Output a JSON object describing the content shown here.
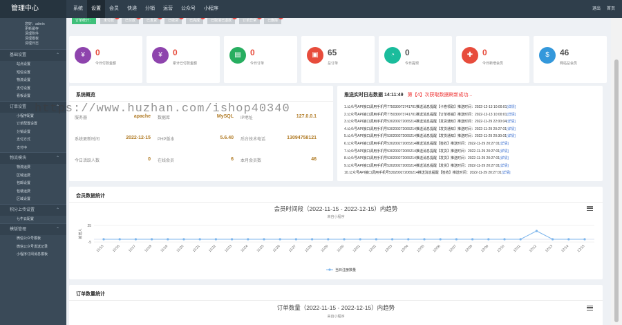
{
  "topbar": {
    "brand": "管理中心",
    "nav": [
      "系统",
      "设置",
      "会员",
      "快递",
      "分销",
      "运营",
      "公众号",
      "小程序"
    ],
    "active_index": 1,
    "right": [
      "退出",
      "首页"
    ]
  },
  "sidebar": {
    "user_lines": [
      "您好：admin",
      "更新缓存",
      "清理附件",
      "清理模板",
      "清理日志"
    ],
    "sections": [
      {
        "title": "基础设置",
        "items": [
          "站点设置",
          "短信设置",
          "物流设置",
          "支付设置",
          "看板设置"
        ]
      },
      {
        "title": "订单设置",
        "items": [
          "小程序配置",
          "订单配置设置",
          "分销设置",
          "支付方式",
          "支付中"
        ]
      },
      {
        "title": "物流模块",
        "items": [
          "物流运费",
          "区域运费",
          "包邮设置",
          "包装运费",
          "区域设置"
        ]
      },
      {
        "title": "积分上传设置",
        "items": [
          "七牛云配置"
        ]
      },
      {
        "title": "模版管理",
        "items": [
          "微信公众号模板",
          "微信公众号发送记录",
          "小程序订阅消息模板"
        ]
      }
    ]
  },
  "filterbar": {
    "chips": [
      "订单统计：",
      "未付款",
      "已付款",
      "已发货",
      "已收货",
      "已完成",
      "已取消已退款",
      "订单异常",
      "已删除"
    ]
  },
  "stats": [
    {
      "value": "0",
      "label": "今日付款金额",
      "icon": "yen-icon",
      "color": "#8e44ad"
    },
    {
      "value": "0",
      "label": "累计已付款金额",
      "icon": "yen-icon",
      "color": "#8e44ad"
    },
    {
      "value": "0",
      "label": "今日订单",
      "icon": "document-icon",
      "color": "#27ae60"
    },
    {
      "value": "65",
      "label": "总订单",
      "icon": "list-icon",
      "color": "#e74c3c"
    },
    {
      "value": "0",
      "label": "今日提现",
      "icon": "pie-icon",
      "color": "#1abc9c"
    },
    {
      "value": "0",
      "label": "今日新增会员",
      "icon": "user-plus-icon",
      "color": "#e74c3c"
    },
    {
      "value": "46",
      "label": "网站总会员",
      "icon": "moneybag-icon",
      "color": "#3498db"
    }
  ],
  "system": {
    "title": "系统概览",
    "rows": [
      [
        {
          "k": "服务器",
          "v": "apache"
        },
        {
          "k": "数据库",
          "v": "MySQL"
        },
        {
          "k": "IP地址",
          "v": "127.0.0.1"
        }
      ],
      [
        {
          "k": "系统更新时间",
          "v": "2022-12-15"
        },
        {
          "k": "PHP版本",
          "v": "5.6.40"
        },
        {
          "k": "后台技术电话",
          "v": "13094758121"
        }
      ],
      [
        {
          "k": "今日活跃人数",
          "v": "0"
        },
        {
          "k": "在线会员",
          "v": "6"
        },
        {
          "k": "本月会员数",
          "v": "46"
        }
      ]
    ]
  },
  "log": {
    "title": "推送实时日志数据 14:11:49",
    "alert": "第【4】次获取数据刷新成功...",
    "lines": [
      {
        "text": "1.公众号API接口调用手机号775030073741701推送消息提醒【卡卷领取】推送时间：2022-12-13 10:00:01",
        "link": "[详情]"
      },
      {
        "text": "2.公众号API接口调用手机号775030073741701推送消息提醒【订单核销】推送时间：2022-12-13 10:00:01",
        "link": "[详情]"
      },
      {
        "text": "3.公众号API接口调用手机号530200272065214推送消息提醒【发货通知】推送时间：2022-11-29 22:00:04",
        "link": "[详情]"
      },
      {
        "text": "4.公众号API接口调用手机号530200272065214推送消息提醒【发货通知】推送时间：2022-11-29 20:27:01",
        "link": "[详情]"
      },
      {
        "text": "5.公众号API接口调用手机号530200272065214推送消息提醒【发货通知】推送时间：2022-11-29 20:30:01",
        "link": "[详情]"
      },
      {
        "text": "6.公众号API接口调用手机号530200272065214推送消息提醒【签收】推送时间：2022-11-29 20:27:01",
        "link": "[详情]"
      },
      {
        "text": "7.公众号API接口调用手机号530200272065214推送消息提醒【发货】推送时间：2022-11-29 20:27:01",
        "link": "[详情]"
      },
      {
        "text": "8.公众号API接口调用手机号530200272065214推送消息提醒【发货】推送时间：2022-11-29 20:27:01",
        "link": "[详情]"
      },
      {
        "text": "9.公众号API接口调用手机号530200272065214推送消息提醒【发货】推送时间：2022-11-29 20:27:01",
        "link": "[详情]"
      },
      {
        "text": "10.公众号API接口调用手机号530200272065214推送消息提醒【签收】推送时间：2022-11-29 20:27:01",
        "link": "[详情]"
      }
    ]
  },
  "member_panel": {
    "title": "会员数据统计"
  },
  "order_panel": {
    "title": "订单数量统计",
    "chart_title": "订单数量（2022-11-15 - 2022-12-15）内趋势",
    "chart_subtitle": "来自小程序"
  },
  "watermark": "https://www.huzhan.com/ishop40340",
  "chart_data": {
    "type": "line",
    "title": "会员时间段（2022-11-15 - 2022-12-15）内趋势",
    "subtitle": "来自小程序",
    "ylabel": "新增人",
    "legend": "当日注册数量",
    "legend_position": "bottom",
    "ylim": [
      -5,
      25
    ],
    "yticks": [
      "25",
      "-5"
    ],
    "categories": [
      "11/15",
      "11/16",
      "11/17",
      "11/18",
      "11/19",
      "11/20",
      "11/21",
      "11/22",
      "11/23",
      "11/24",
      "11/25",
      "11/26",
      "11/27",
      "11/28",
      "11/29",
      "11/30",
      "12/01",
      "12/02",
      "12/03",
      "12/04",
      "12/05",
      "12/06",
      "12/07",
      "12/08",
      "12/09",
      "12/10",
      "12/11",
      "12/12",
      "12/13",
      "12/14",
      "12/15"
    ],
    "series": [
      {
        "name": "当日注册数量",
        "values": [
          0,
          0,
          0,
          0,
          0,
          0,
          0,
          0,
          0,
          0,
          0,
          0,
          0,
          0,
          0,
          0,
          0,
          0,
          0,
          0,
          0,
          0,
          0,
          0,
          0,
          0,
          0,
          15,
          0,
          0,
          0
        ],
        "color": "#7cb5ec"
      }
    ]
  }
}
